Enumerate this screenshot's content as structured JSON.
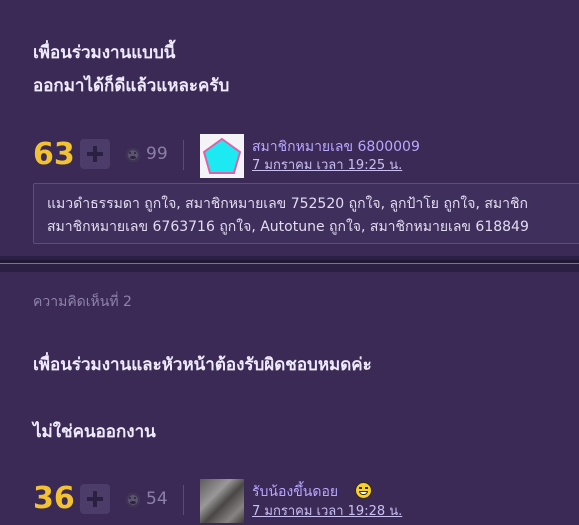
{
  "post1": {
    "text_lines": [
      "เพื่อนร่วมงานแบบนี้",
      "ออกมาได้ก็ดีแล้วแหละครับ"
    ],
    "score": "63",
    "emoji_count": "99",
    "username": "สมาชิกหมายเลข 6800009",
    "timestamp": "7 มกราคม เวลา 19:25 น.",
    "likes_lines": [
      "แมวดำธรรมดา ถูกใจ, สมาชิกหมายเลข 752520 ถูกใจ, ลูกป้าโย ถูกใจ, สมาชิก",
      "สมาชิกหมายเลข 6763716 ถูกใจ, Autotune ถูกใจ, สมาชิกหมายเลข 618849"
    ]
  },
  "post2": {
    "label": "ความคิดเห็นที่ 2",
    "text_lines": [
      "เพื่อนร่วมงานและหัวหน้าต้องรับผิดชอบหมดค่ะ",
      "ไม่ใช่คนออกงาน"
    ],
    "score": "36",
    "emoji_count": "54",
    "username": "รับน้องขึ้นดอย",
    "timestamp": "7 มกราคม เวลา 19:28 น."
  },
  "colors": {
    "background": "#2b1f44",
    "card": "#3a2a55",
    "score": "#f2c232",
    "username": "#b9a8ff"
  },
  "icons": [
    "plus-icon",
    "emotion-icon",
    "laughing-face-icon"
  ]
}
